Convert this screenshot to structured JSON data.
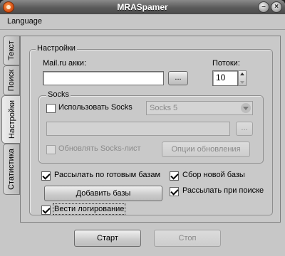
{
  "window": {
    "title": "MRASpamer"
  },
  "menu": {
    "language": "Language"
  },
  "tabs": [
    "Текст",
    "Поиск",
    "Настройки",
    "Статистика"
  ],
  "settings": {
    "group_title": "Настройки",
    "mail_label": "Mail.ru акки:",
    "mail_value": "",
    "browse_label": "...",
    "threads_label": "Потоки:",
    "threads_value": "10",
    "socks": {
      "group_title": "Socks",
      "use_socks_label": "Использовать Socks",
      "socks_type": "Socks 5",
      "path_value": "",
      "browse_label": "...",
      "update_list_label": "Обновлять Socks-лист",
      "update_options_label": "Опции обновления"
    },
    "send_ready_label": "Рассылать по готовым базам",
    "add_bases_label": "Добавить базы",
    "collect_new_label": "Сбор новой базы",
    "send_on_search_label": "Рассылать при поиске",
    "logging_label": "Вести логирование"
  },
  "footer": {
    "start_label": "Старт",
    "stop_label": "Стоп"
  }
}
